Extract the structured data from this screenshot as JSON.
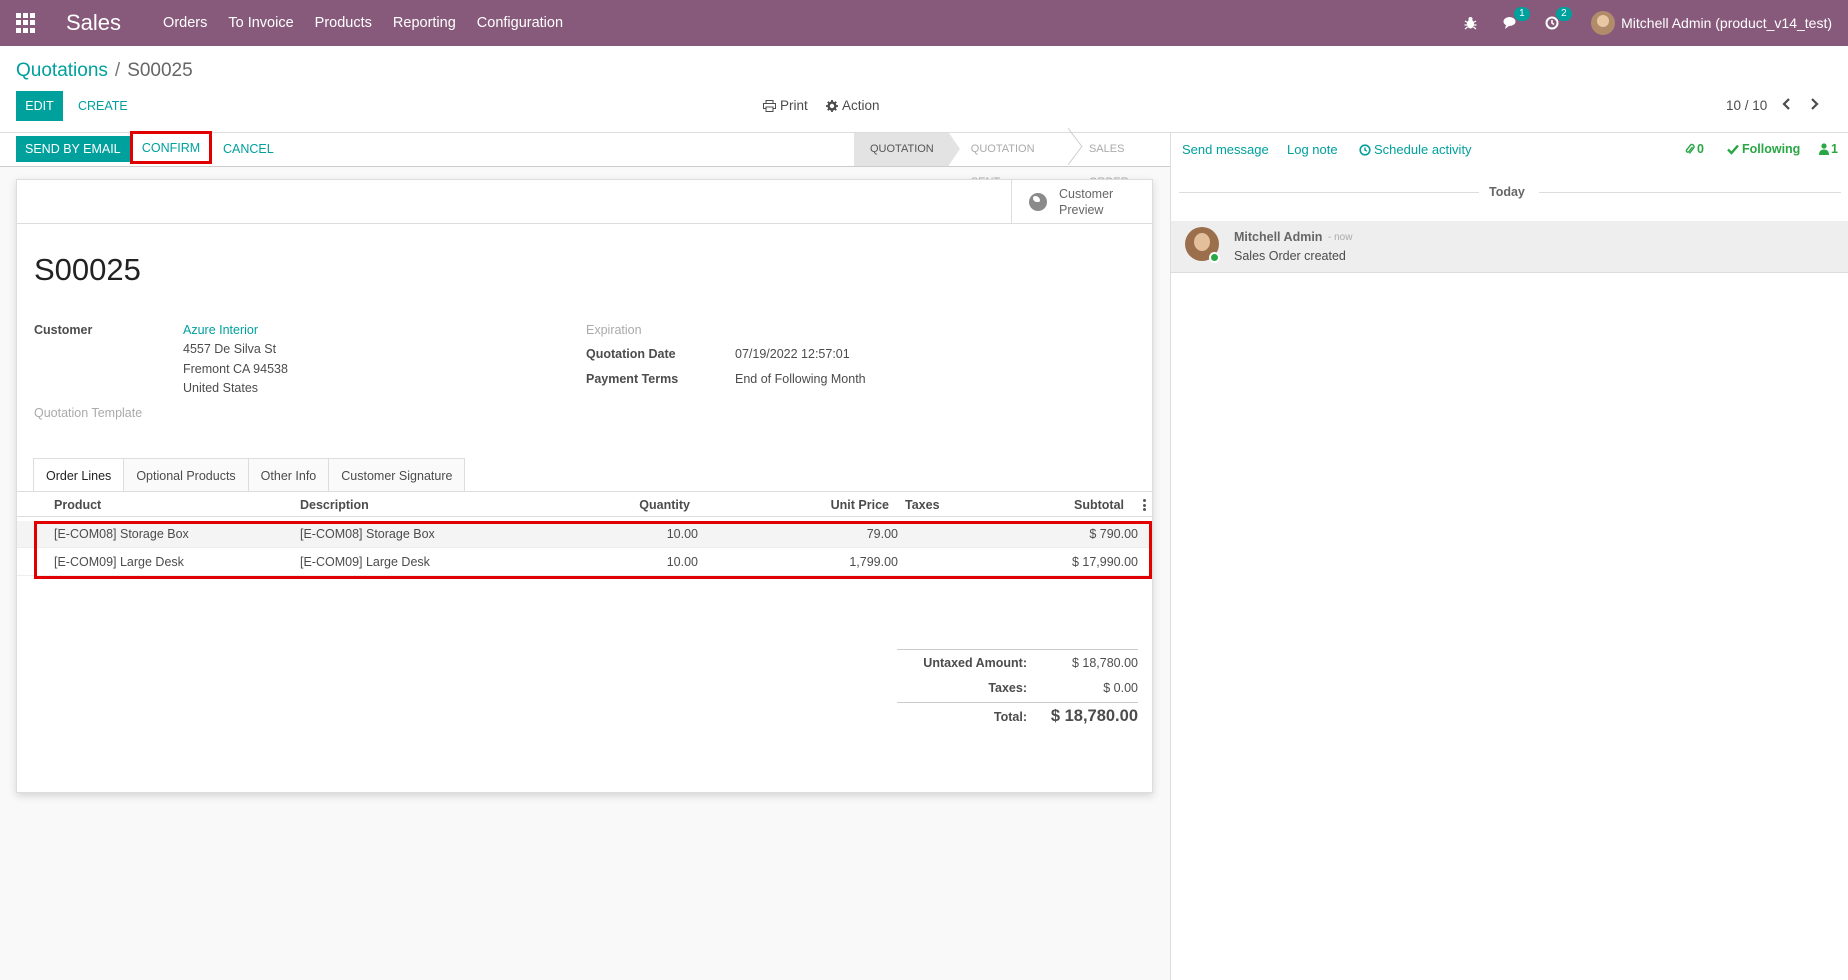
{
  "navbar": {
    "app_name": "Sales",
    "menu": [
      "Orders",
      "To Invoice",
      "Products",
      "Reporting",
      "Configuration"
    ],
    "messages_badge": "1",
    "activities_badge": "2",
    "user_name": "Mitchell Admin (product_v14_test)",
    "icons": [
      "apps-icon",
      "bug-icon",
      "chat-icon",
      "clock-icon"
    ]
  },
  "breadcrumb": {
    "parent": "Quotations",
    "separator": "/",
    "current": "S00025"
  },
  "control": {
    "edit_label": "EDIT",
    "create_label": "CREATE",
    "print_label": "Print",
    "action_label": "Action",
    "pager": "10 / 10"
  },
  "statusbar": {
    "send_email_label": "SEND BY EMAIL",
    "confirm_label": "CONFIRM",
    "cancel_label": "CANCEL",
    "stages": [
      "QUOTATION",
      "QUOTATION SENT",
      "SALES ORDER"
    ],
    "active_stage": "QUOTATION"
  },
  "form": {
    "preview_label_1": "Customer",
    "preview_label_2": "Preview",
    "title": "S00025",
    "customer_label": "Customer",
    "customer_name": "Azure Interior",
    "address_line1": "4557 De Silva St",
    "address_line2": "Fremont CA 94538",
    "address_line3": "United States",
    "template_label": "Quotation Template",
    "expiration_label": "Expiration",
    "quotation_date_label": "Quotation Date",
    "quotation_date": "07/19/2022 12:57:01",
    "payment_terms_label": "Payment Terms",
    "payment_terms": "End of Following Month"
  },
  "tabs": [
    "Order Lines",
    "Optional Products",
    "Other Info",
    "Customer Signature"
  ],
  "order_lines": {
    "columns": [
      "Product",
      "Description",
      "Quantity",
      "Unit Price",
      "Taxes",
      "Subtotal"
    ],
    "rows": [
      {
        "product": "[E-COM08] Storage Box",
        "description": "[E-COM08] Storage Box",
        "quantity": "10.00",
        "unit_price": "79.00",
        "taxes": "",
        "subtotal": "$ 790.00"
      },
      {
        "product": "[E-COM09] Large Desk",
        "description": "[E-COM09] Large Desk",
        "quantity": "10.00",
        "unit_price": "1,799.00",
        "taxes": "",
        "subtotal": "$ 17,990.00"
      }
    ]
  },
  "totals": {
    "untaxed_label": "Untaxed Amount:",
    "untaxed_value": "$ 18,780.00",
    "taxes_label": "Taxes:",
    "taxes_value": "$ 0.00",
    "total_label": "Total:",
    "total_value": "$ 18,780.00"
  },
  "chatter": {
    "send_message": "Send message",
    "log_note": "Log note",
    "schedule_activity": "Schedule activity",
    "attachments_count": "0",
    "following_label": "Following",
    "followers_count": "1",
    "date_separator": "Today",
    "message_author": "Mitchell Admin",
    "message_time": "- now",
    "message_body": "Sales Order created"
  },
  "colors": {
    "brand": "#875a7b",
    "accent": "#00a09d",
    "highlight": "#e00000"
  }
}
